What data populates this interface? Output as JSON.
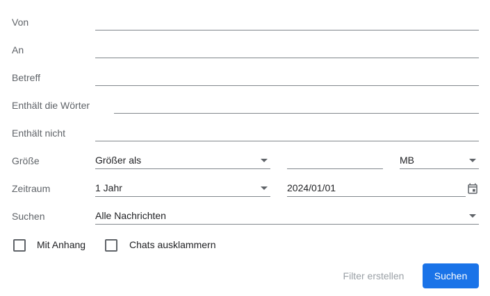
{
  "fields": {
    "from": {
      "label": "Von",
      "value": ""
    },
    "to": {
      "label": "An",
      "value": ""
    },
    "subject": {
      "label": "Betreff",
      "value": ""
    },
    "has_words": {
      "label": "Enthält die Wörter",
      "value": ""
    },
    "doesnt_have": {
      "label": "Enthält nicht",
      "value": ""
    }
  },
  "size": {
    "label": "Größe",
    "operator": "Größer als",
    "amount": "",
    "unit": "MB"
  },
  "date_within": {
    "label": "Zeitraum",
    "range": "1 Jahr",
    "date": "2024/01/01",
    "icon": "calendar-icon"
  },
  "search_in": {
    "label": "Suchen",
    "value": "Alle Nachrichten"
  },
  "checkboxes": {
    "has_attachment": {
      "label": "Mit Anhang",
      "checked": false
    },
    "exclude_chats": {
      "label": "Chats ausklammern",
      "checked": false
    }
  },
  "buttons": {
    "create_filter": "Filter erstellen",
    "search": "Suchen"
  },
  "colors": {
    "primary": "#1a73e8",
    "label": "#5f6368",
    "disabled_text": "#9aa0a6",
    "underline": "#80868b"
  }
}
